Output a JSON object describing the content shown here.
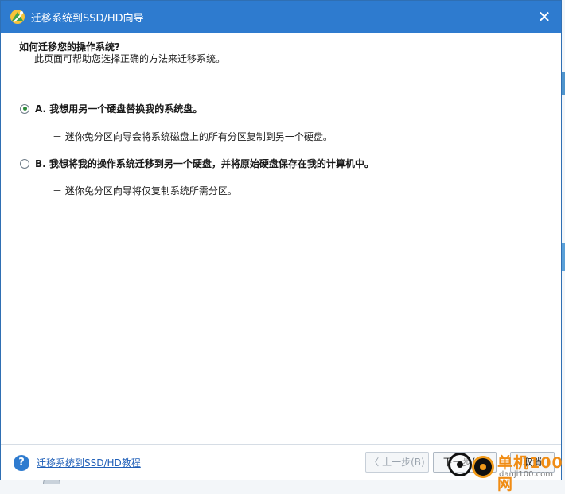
{
  "window": {
    "title": "迁移系统到SSD/HD向导",
    "close_glyph": "✕"
  },
  "header": {
    "title": "如何迁移您的操作系统?",
    "subtitle": "此页面可帮助您选择正确的方法来迁移系统。"
  },
  "options": [
    {
      "label": "A. 我想用另一个硬盘替换我的系统盘。",
      "description": "－ 迷你兔分区向导会将系统磁盘上的所有分区复制到另一个硬盘。",
      "selected": true
    },
    {
      "label": "B. 我想将我的操作系统迁移到另一个硬盘，并将原始硬盘保存在我的计算机中。",
      "description": "－ 迷你兔分区向导将仅复制系统所需分区。",
      "selected": false
    }
  ],
  "footer": {
    "help_glyph": "?",
    "help_link": "迁移系统到SSD/HD教程",
    "back_label": "〈 上一步(B)",
    "next_label": "下一步(N)",
    "cancel_label": "取消"
  },
  "watermark": {
    "text_cn": "单机100网",
    "text_en": "danji100.com"
  },
  "colors": {
    "titlebar": "#2e7bcf",
    "link": "#1f5fb8",
    "radio_selected": "#2c8a3a",
    "watermark": "#f08c14"
  }
}
